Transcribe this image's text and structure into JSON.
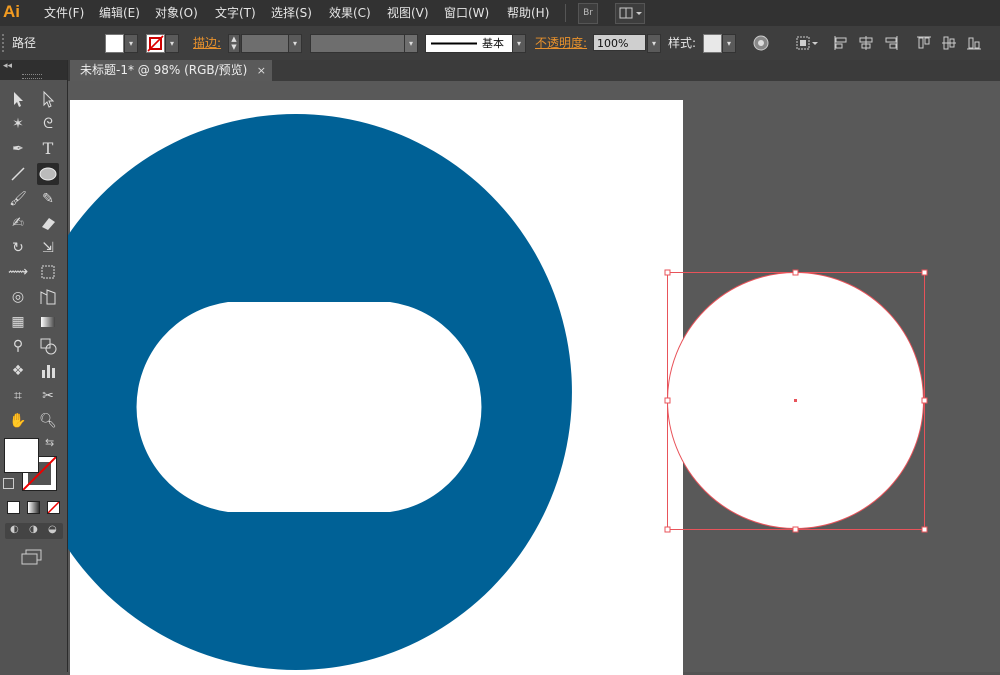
{
  "app": {
    "logo": "Ai"
  },
  "menu": [
    "文件(F)",
    "编辑(E)",
    "对象(O)",
    "文字(T)",
    "选择(S)",
    "效果(C)",
    "视图(V)",
    "窗口(W)",
    "帮助(H)"
  ],
  "menubar_buttons": {
    "bridge": "Br"
  },
  "control": {
    "object_type": "路径",
    "stroke_label": "描边:",
    "stroke_style": "基本",
    "opacity_label": "不透明度:",
    "opacity_value": "100%",
    "style_label": "样式:"
  },
  "document_tab": {
    "title": "未标题-1* @ 98% (RGB/预览)",
    "close": "×"
  },
  "colors": {
    "brand": "#F29B21",
    "shape_fill": "#006196",
    "selection": "#E8535A",
    "artboard": "#FFFFFF",
    "pasteboard": "#595959"
  },
  "tools": [
    "selection-tool",
    "direct-selection-tool",
    "magic-wand-tool",
    "lasso-tool",
    "pen-tool",
    "type-tool",
    "line-tool",
    "ellipse-tool",
    "paintbrush-tool",
    "pencil-tool",
    "blob-brush-tool",
    "eraser-tool",
    "rotate-tool",
    "scale-tool",
    "width-tool",
    "free-transform-tool",
    "shape-builder-tool",
    "perspective-grid-tool",
    "mesh-tool",
    "gradient-tool",
    "eyedropper-tool",
    "blend-tool",
    "symbol-sprayer-tool",
    "column-graph-tool",
    "artboard-tool",
    "slice-tool",
    "hand-tool",
    "zoom-tool"
  ]
}
